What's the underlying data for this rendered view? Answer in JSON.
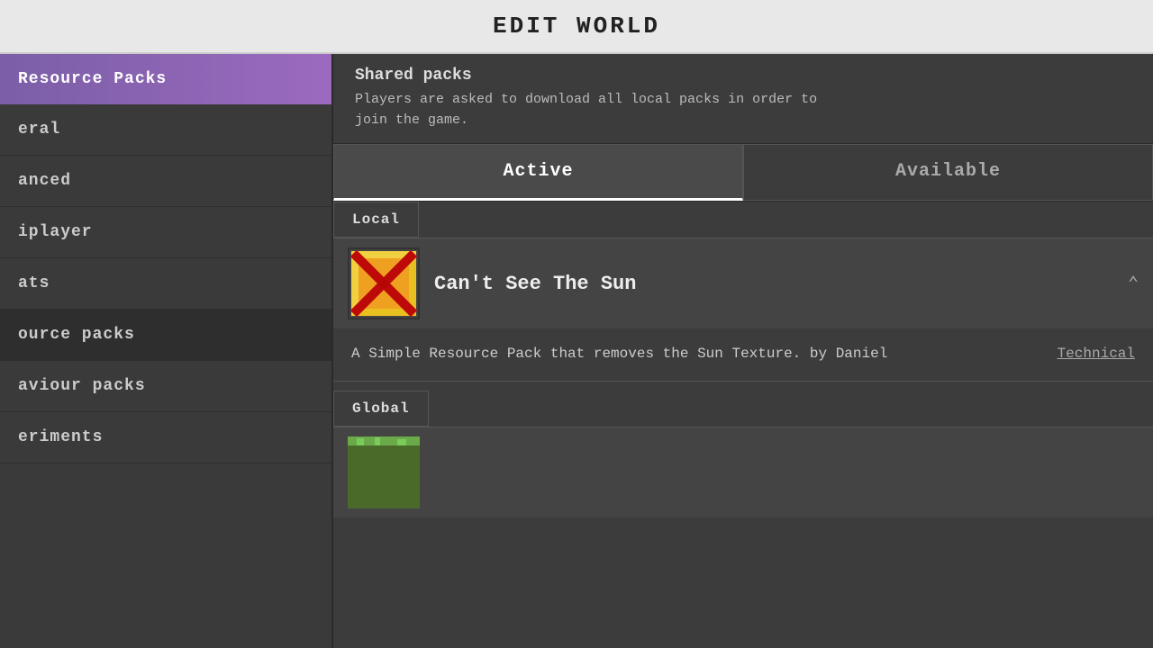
{
  "header": {
    "title": "EDIT WORLD"
  },
  "sidebar": {
    "items": [
      {
        "id": "resource-packs-title",
        "label": "Resource Packs",
        "active": true,
        "highlighted": true
      },
      {
        "id": "general",
        "label": "General",
        "active": false
      },
      {
        "id": "advanced",
        "label": "Advanced",
        "active": false
      },
      {
        "id": "multiplayer",
        "label": "Multiplayer",
        "active": false
      },
      {
        "id": "cheats",
        "label": "Cheats",
        "active": false
      },
      {
        "id": "resource-packs",
        "label": "Resource Packs",
        "active": true
      },
      {
        "id": "behaviour-packs",
        "label": "Behaviour Packs",
        "active": false
      },
      {
        "id": "experiments",
        "label": "Experiments",
        "active": false
      }
    ]
  },
  "main": {
    "shared_packs_title": "Shared packs",
    "shared_packs_desc": "Players are asked to download all local packs in order to\njoin the game.",
    "tabs": [
      {
        "id": "active",
        "label": "Active",
        "active": true
      },
      {
        "id": "available",
        "label": "Available",
        "active": false
      }
    ],
    "local_section": {
      "label": "Local",
      "packs": [
        {
          "name": "Can't See The Sun",
          "description": "A Simple Resource Pack that removes the Sun Texture. by Daniel",
          "technical_label": "Technical"
        }
      ]
    },
    "global_section": {
      "label": "Global",
      "packs": []
    }
  },
  "colors": {
    "sidebar_active_bg": "#7b5ea7",
    "header_bg": "#e8e8e8",
    "main_bg": "#3c3c3c",
    "tab_active_bg": "#4a4a4a",
    "resource_packs_item_bg": "#2e2e2e"
  }
}
